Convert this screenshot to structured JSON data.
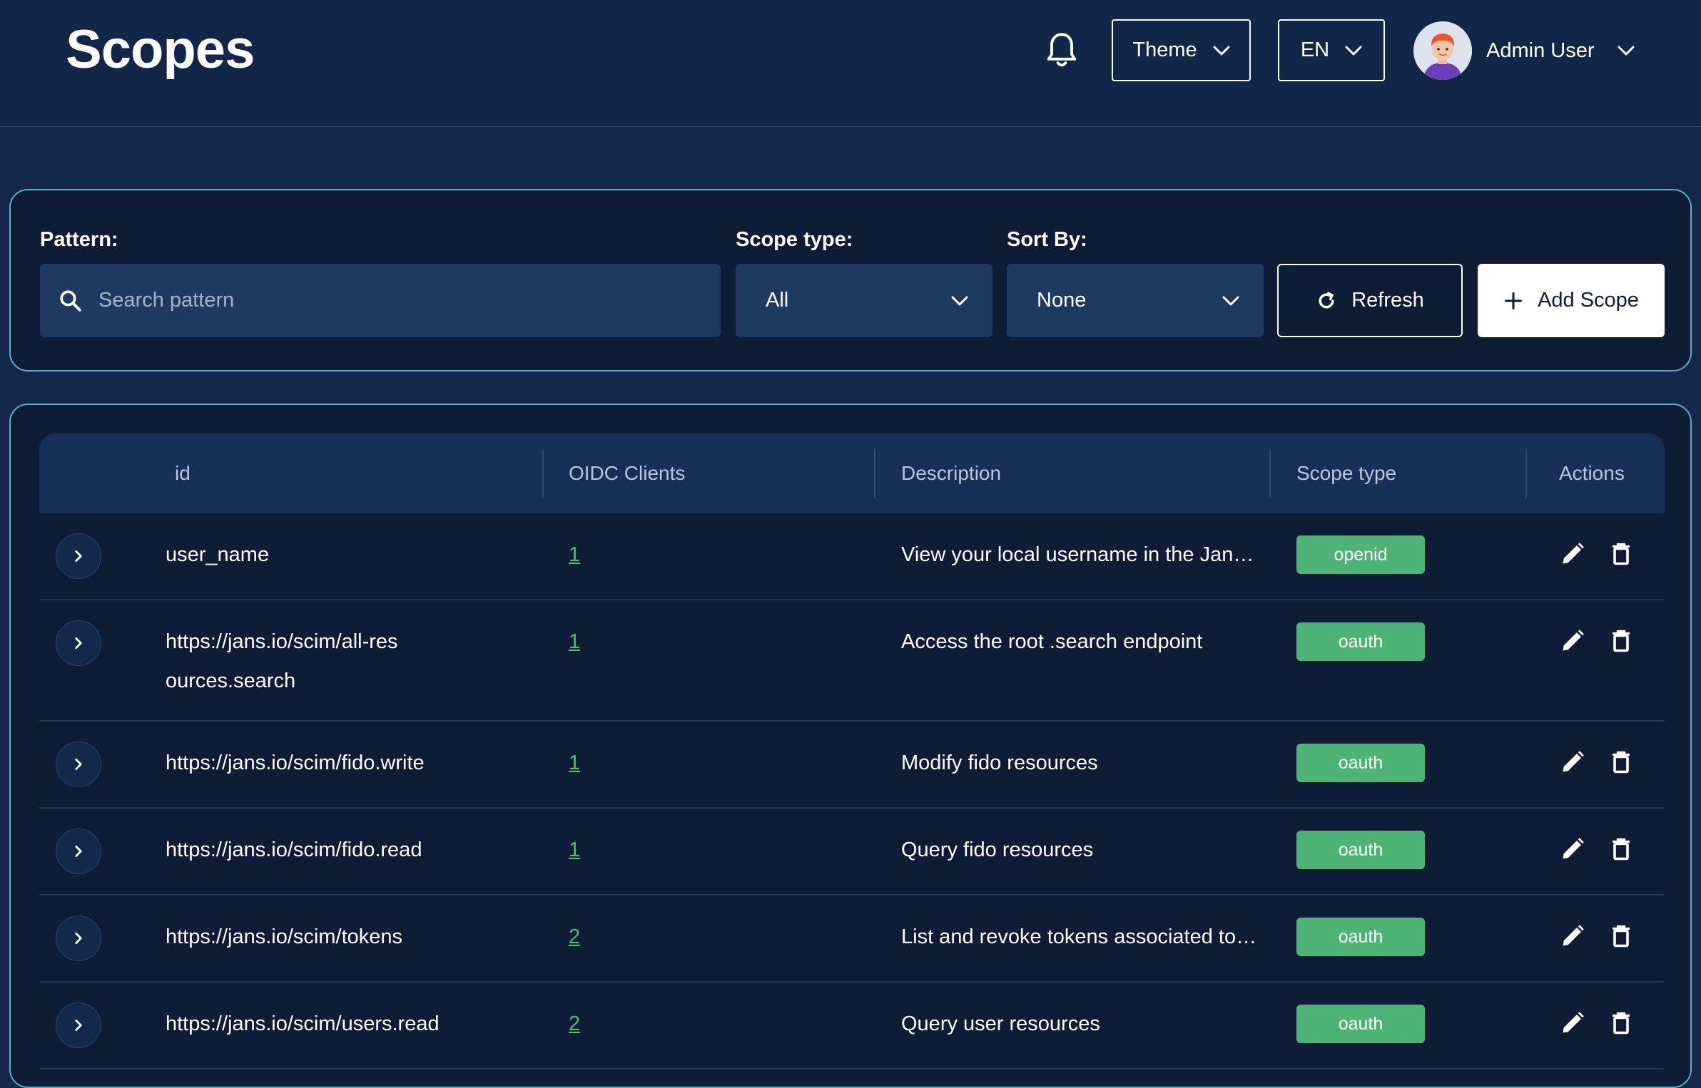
{
  "header": {
    "title": "Scopes",
    "theme_label": "Theme",
    "language_label": "EN",
    "user_name": "Admin User"
  },
  "filters": {
    "pattern_label": "Pattern:",
    "pattern_placeholder": "Search pattern",
    "pattern_value": "",
    "scope_type_label": "Scope type:",
    "scope_type_value": "All",
    "sort_label": "Sort By:",
    "sort_value": "None",
    "refresh_label": "Refresh",
    "add_label": "Add Scope"
  },
  "table": {
    "columns": [
      "id",
      "OIDC Clients",
      "Description",
      "Scope type",
      "Actions"
    ],
    "rows": [
      {
        "id": "user_name",
        "clients": "1",
        "description": "View your local username in the Janssen Server.",
        "type": "openid"
      },
      {
        "id": "https://jans.io/scim/all-resources.search",
        "clients": "1",
        "description": "Access the root .search endpoint",
        "type": "oauth"
      },
      {
        "id": "https://jans.io/scim/fido.write",
        "clients": "1",
        "description": "Modify fido resources",
        "type": "oauth"
      },
      {
        "id": "https://jans.io/scim/fido.read",
        "clients": "1",
        "description": "Query fido resources",
        "type": "oauth"
      },
      {
        "id": "https://jans.io/scim/tokens",
        "clients": "2",
        "description": "List and revoke tokens associated to users",
        "type": "oauth"
      },
      {
        "id": "https://jans.io/scim/users.read",
        "clients": "2",
        "description": "Query user resources",
        "type": "oauth"
      }
    ]
  },
  "colors": {
    "background": "#14284a",
    "card": "#0e1c36",
    "card_border": "#4fb3c8",
    "badge": "#4eb475",
    "link": "#4fbe7a"
  },
  "icons": {
    "notifications": "bell-icon",
    "search": "search-icon",
    "refresh": "refresh-icon",
    "add": "plus-icon",
    "expand": "chevron-right-icon",
    "edit": "pencil-icon",
    "delete": "trash-icon"
  }
}
